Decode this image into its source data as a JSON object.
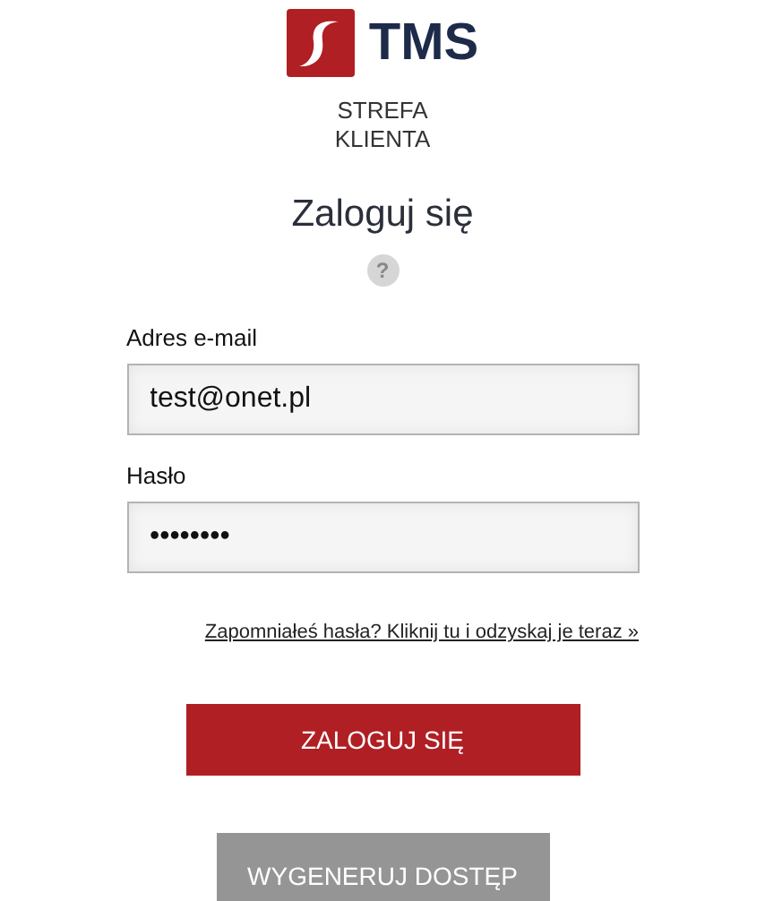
{
  "logo": {
    "text": "TMS"
  },
  "subtitle": [
    "STREFA",
    "KLIENTA"
  ],
  "title": "Zaloguj się",
  "help": "?",
  "fields": [
    {
      "label": "Adres e-mail",
      "value": "test@onet.pl"
    },
    {
      "label": "Hasło",
      "value": "••••••••"
    }
  ],
  "forgot_link": "Zapomniałeś hasła? Kliknij tu i odzyskaj je teraz »",
  "buttons": [
    {
      "label": "ZALOGUJ SIĘ",
      "kind": "primary"
    },
    {
      "label": "WYGENERUJ DOSTĘP",
      "kind": "secondary"
    }
  ]
}
